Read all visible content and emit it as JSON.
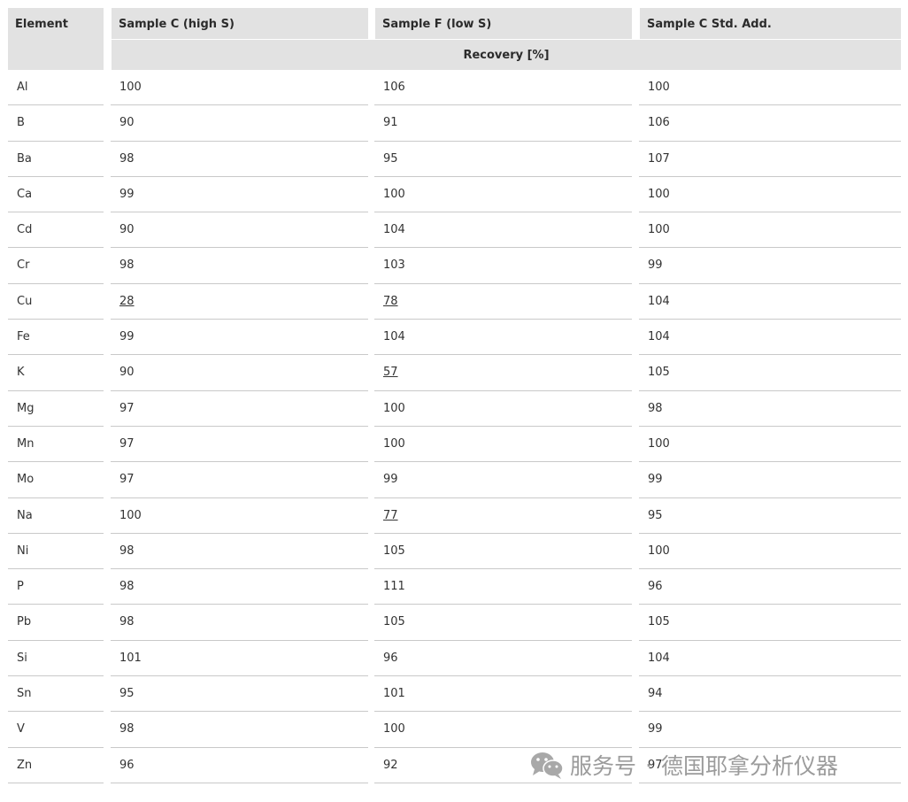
{
  "table": {
    "headers": {
      "element": "Element",
      "sample_c": "Sample C (high S)",
      "sample_f": "Sample F (low S)",
      "sample_c_std": "Sample C Std. Add.",
      "recovery": "Recovery [%]"
    },
    "rows": [
      {
        "element": "Al",
        "c": "100",
        "f": "106",
        "s": "100",
        "c_ul": false,
        "f_ul": false
      },
      {
        "element": "B",
        "c": "90",
        "f": "91",
        "s": "106",
        "c_ul": false,
        "f_ul": false
      },
      {
        "element": "Ba",
        "c": "98",
        "f": "95",
        "s": "107",
        "c_ul": false,
        "f_ul": false
      },
      {
        "element": "Ca",
        "c": "99",
        "f": "100",
        "s": "100",
        "c_ul": false,
        "f_ul": false
      },
      {
        "element": "Cd",
        "c": "90",
        "f": "104",
        "s": "100",
        "c_ul": false,
        "f_ul": false
      },
      {
        "element": "Cr",
        "c": "98",
        "f": "103",
        "s": "99",
        "c_ul": false,
        "f_ul": false
      },
      {
        "element": "Cu",
        "c": "28",
        "f": "78",
        "s": "104",
        "c_ul": true,
        "f_ul": true
      },
      {
        "element": "Fe",
        "c": "99",
        "f": "104",
        "s": "104",
        "c_ul": false,
        "f_ul": false
      },
      {
        "element": "K",
        "c": "90",
        "f": "57",
        "s": "105",
        "c_ul": false,
        "f_ul": true
      },
      {
        "element": "Mg",
        "c": "97",
        "f": "100",
        "s": "98",
        "c_ul": false,
        "f_ul": false
      },
      {
        "element": "Mn",
        "c": "97",
        "f": "100",
        "s": "100",
        "c_ul": false,
        "f_ul": false
      },
      {
        "element": "Mo",
        "c": "97",
        "f": "99",
        "s": "99",
        "c_ul": false,
        "f_ul": false
      },
      {
        "element": "Na",
        "c": "100",
        "f": "77",
        "s": "95",
        "c_ul": false,
        "f_ul": true
      },
      {
        "element": "Ni",
        "c": "98",
        "f": "105",
        "s": "100",
        "c_ul": false,
        "f_ul": false
      },
      {
        "element": "P",
        "c": "98",
        "f": "111",
        "s": "96",
        "c_ul": false,
        "f_ul": false
      },
      {
        "element": "Pb",
        "c": "98",
        "f": "105",
        "s": "105",
        "c_ul": false,
        "f_ul": false
      },
      {
        "element": "Si",
        "c": "101",
        "f": "96",
        "s": "104",
        "c_ul": false,
        "f_ul": false
      },
      {
        "element": "Sn",
        "c": "95",
        "f": "101",
        "s": "94",
        "c_ul": false,
        "f_ul": false
      },
      {
        "element": "V",
        "c": "98",
        "f": "100",
        "s": "99",
        "c_ul": false,
        "f_ul": false
      },
      {
        "element": "Zn",
        "c": "96",
        "f": "92",
        "s": "97",
        "c_ul": false,
        "f_ul": false
      }
    ]
  },
  "watermark": {
    "icon": "wechat-icon",
    "left_text": "服务号",
    "separator": "·",
    "right_text": "德国耶拿分析仪器"
  }
}
